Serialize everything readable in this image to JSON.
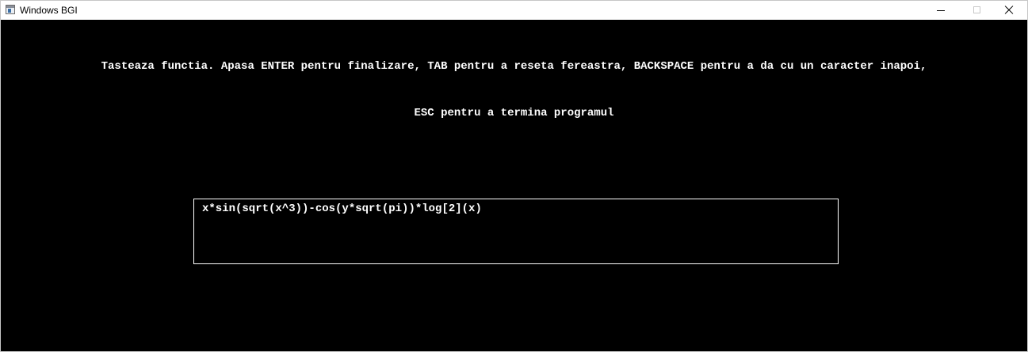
{
  "window": {
    "title": "Windows BGI",
    "icon": "bgi-window-icon",
    "controls": {
      "minimize": "minimize-icon",
      "maximize": "maximize-icon",
      "close": "close-icon"
    }
  },
  "canvas": {
    "background": "#000000",
    "text_color": "#ffffff",
    "instruction_line_1": "Tasteaza functia. Apasa ENTER pentru finalizare, TAB pentru a reseta fereastra, BACKSPACE pentru a da cu un caracter inapoi,",
    "instruction_line_2": "ESC pentru a termina programul",
    "input": {
      "value": "x*sin(sqrt(x^3))-cos(y*sqrt(pi))*log[2](x)",
      "border_color": "#ffffff"
    }
  }
}
